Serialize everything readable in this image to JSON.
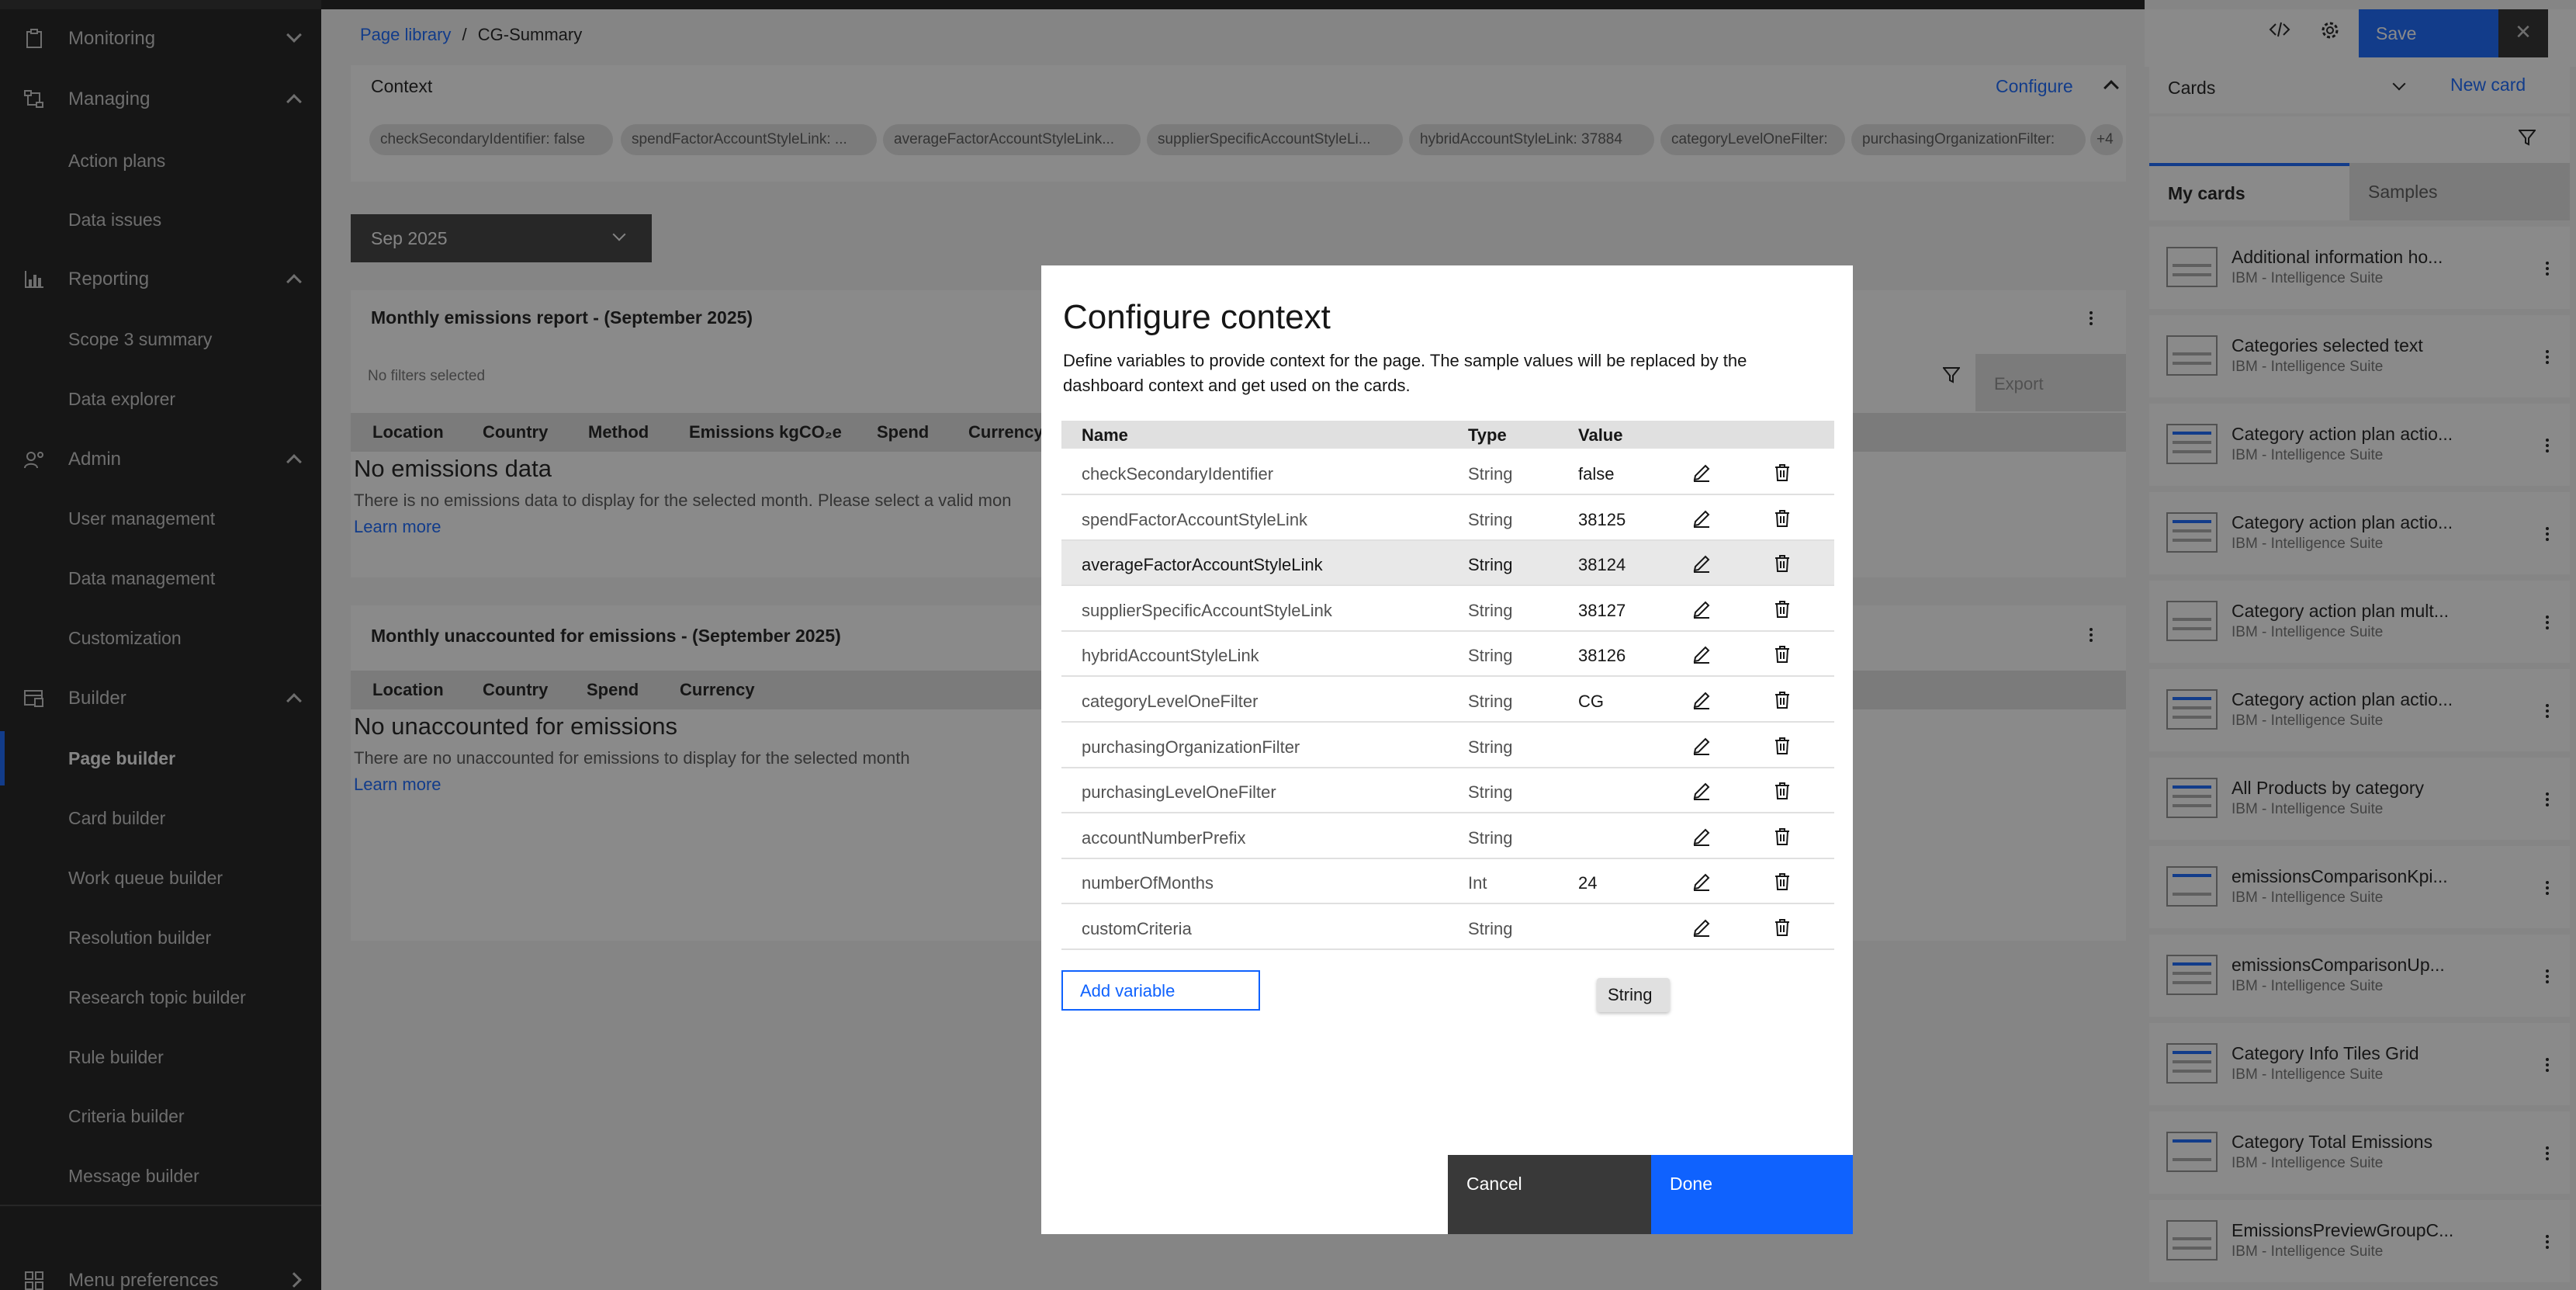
{
  "sidebar": {
    "sections": [
      {
        "label": "Monitoring",
        "icon": "clipboard-icon"
      },
      {
        "label": "Managing",
        "icon": "flow-icon",
        "items": [
          "Action plans",
          "Data issues"
        ]
      },
      {
        "label": "Reporting",
        "icon": "chart-bar-icon",
        "items": [
          "Scope 3 summary",
          "Data explorer"
        ]
      },
      {
        "label": "Admin",
        "icon": "user-admin-icon",
        "items": [
          "User management",
          "Data management",
          "Customization"
        ]
      },
      {
        "label": "Builder",
        "icon": "builder-icon",
        "items": [
          "Page builder",
          "Card builder",
          "Work queue builder",
          "Resolution builder",
          "Research topic builder",
          "Rule builder",
          "Criteria builder",
          "Message builder"
        ]
      }
    ],
    "active_item": "Page builder",
    "footer": {
      "label": "Menu preferences",
      "icon": "grid-icon"
    }
  },
  "breadcrumb": {
    "parent": "Page library",
    "separator": "/",
    "current": "CG-Summary"
  },
  "context_bar": {
    "title": "Context",
    "configure_label": "Configure",
    "tags": [
      "checkSecondaryIdentifier: false",
      "spendFactorAccountStyleLink: ...",
      "averageFactorAccountStyleLink...",
      "supplierSpecificAccountStyleLi...",
      "hybridAccountStyleLink: 37884",
      "categoryLevelOneFilter:",
      "purchasingOrganizationFilter:",
      "+4"
    ]
  },
  "month_select": {
    "value": "Sep 2025"
  },
  "report1": {
    "title": "Monthly emissions report - (September 2025)",
    "filters_text": "No filters selected",
    "export_label": "Export",
    "columns": [
      "Location",
      "Country",
      "Method",
      "Emissions kgCO₂e",
      "Spend",
      "Currency"
    ],
    "empty_title": "No emissions data",
    "empty_text": "There is no emissions data to display for the selected month. Please select a valid mon",
    "learn_more": "Learn more"
  },
  "report2": {
    "title": "Monthly unaccounted for emissions - (September 2025)",
    "columns": [
      "Location",
      "Country",
      "Spend",
      "Currency"
    ],
    "empty_title": "No unaccounted for emissions",
    "empty_text": "There are no unaccounted for emissions to display for the selected month",
    "learn_more": "Learn more"
  },
  "toolbar": {
    "save_label": "Save",
    "code_icon": "code-icon",
    "settings_icon": "gear-icon",
    "close_icon": "close-icon"
  },
  "cards_panel": {
    "dropdown_label": "Cards",
    "new_card_label": "New card",
    "tabs": [
      "My cards",
      "Samples"
    ],
    "items": [
      {
        "title": "Additional information ho...",
        "subtitle": "IBM - Intelligence Suite"
      },
      {
        "title": "Categories selected text",
        "subtitle": "IBM - Intelligence Suite"
      },
      {
        "title": "Category action plan actio...",
        "subtitle": "IBM - Intelligence Suite"
      },
      {
        "title": "Category action plan actio...",
        "subtitle": "IBM - Intelligence Suite"
      },
      {
        "title": "Category action plan mult...",
        "subtitle": "IBM - Intelligence Suite"
      },
      {
        "title": "Category action plan actio...",
        "subtitle": "IBM - Intelligence Suite"
      },
      {
        "title": "All Products by category",
        "subtitle": "IBM - Intelligence Suite"
      },
      {
        "title": "emissionsComparisonKpi...",
        "subtitle": "IBM - Intelligence Suite"
      },
      {
        "title": "emissionsComparisonUp...",
        "subtitle": "IBM - Intelligence Suite"
      },
      {
        "title": "Category Info Tiles Grid",
        "subtitle": "IBM - Intelligence Suite"
      },
      {
        "title": "Category Total Emissions",
        "subtitle": "IBM - Intelligence Suite"
      },
      {
        "title": "EmissionsPreviewGroupC...",
        "subtitle": "IBM - Intelligence Suite"
      }
    ]
  },
  "modal": {
    "title": "Configure context",
    "description_line1": "Define variables to provide context for the page. The sample values will be replaced by the",
    "description_line2": "dashboard context and get used on the cards.",
    "columns": {
      "name": "Name",
      "type": "Type",
      "value": "Value"
    },
    "rows": [
      {
        "name": "checkSecondaryIdentifier",
        "type": "String",
        "value": "false"
      },
      {
        "name": "spendFactorAccountStyleLink",
        "type": "String",
        "value": "38125"
      },
      {
        "name": "averageFactorAccountStyleLink",
        "type": "String",
        "value": "38124"
      },
      {
        "name": "supplierSpecificAccountStyleLink",
        "type": "String",
        "value": "38127"
      },
      {
        "name": "hybridAccountStyleLink",
        "type": "String",
        "value": "38126"
      },
      {
        "name": "categoryLevelOneFilter",
        "type": "String",
        "value": "CG"
      },
      {
        "name": "purchasingOrganizationFilter",
        "type": "String",
        "value": ""
      },
      {
        "name": "purchasingLevelOneFilter",
        "type": "String",
        "value": ""
      },
      {
        "name": "accountNumberPrefix",
        "type": "String",
        "value": ""
      },
      {
        "name": "numberOfMonths",
        "type": "Int",
        "value": "24"
      },
      {
        "name": "customCriteria",
        "type": "String",
        "value": ""
      }
    ],
    "add_variable_label": "Add variable",
    "tooltip_text": "String",
    "cancel_label": "Cancel",
    "done_label": "Done"
  }
}
